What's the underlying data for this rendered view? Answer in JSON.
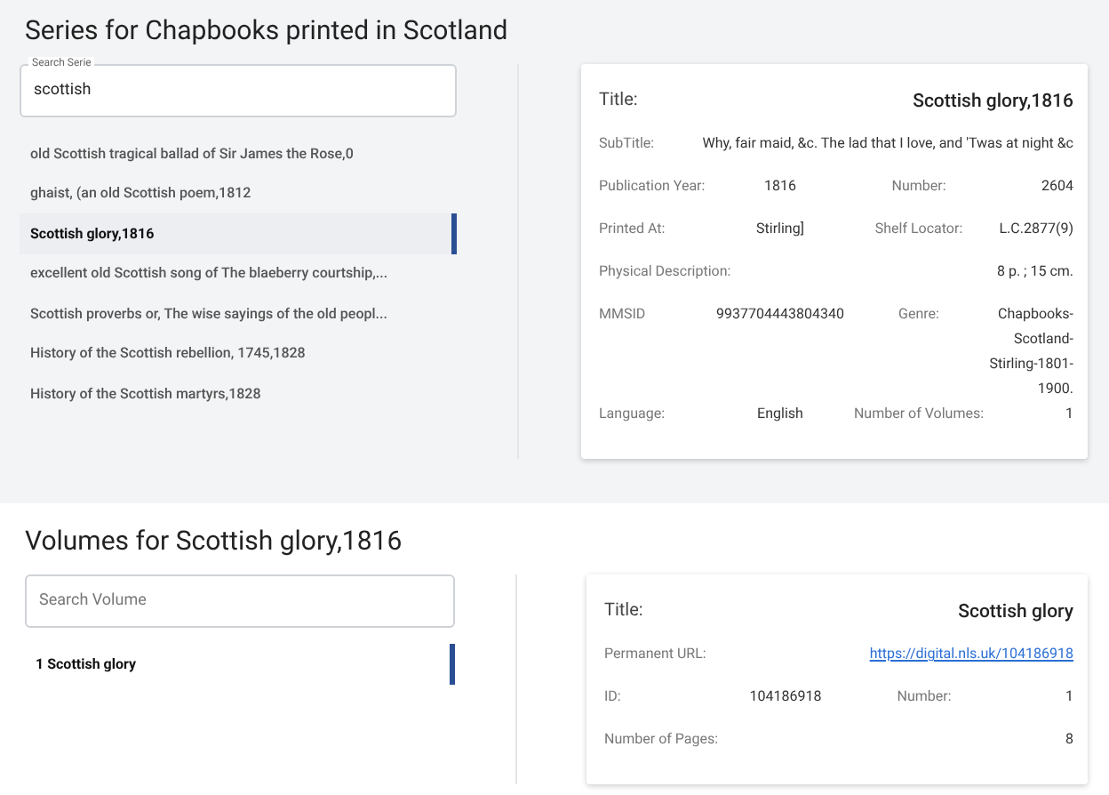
{
  "series": {
    "heading": "Series for Chapbooks printed in Scotland",
    "search": {
      "label": "Search Serie",
      "value": "scottish"
    },
    "items": [
      {
        "text": "old Scottish tragical ballad of Sir James the Rose,0",
        "selected": false
      },
      {
        "text": "ghaist, (an old Scottish poem,1812",
        "selected": false
      },
      {
        "text": "Scottish glory,1816",
        "selected": true
      },
      {
        "text": "excellent old Scottish song of The blaeberry courtship,...",
        "selected": false
      },
      {
        "text": "Scottish proverbs or, The wise sayings of the old peopl...",
        "selected": false
      },
      {
        "text": "History of the Scottish rebellion, 1745,1828",
        "selected": false
      },
      {
        "text": "History of the Scottish martyrs,1828",
        "selected": false
      }
    ],
    "detail": {
      "title_label": "Title:",
      "title_value": "Scottish glory,1816",
      "rows": [
        {
          "kind": "single",
          "label": "SubTitle:",
          "value": "Why, fair maid, &c. The lad that I love, and 'Twas at night &c"
        },
        {
          "kind": "pair",
          "fields": [
            {
              "label": "Publication Year:",
              "value": "1816"
            },
            {
              "label": "Number:",
              "value": "2604"
            }
          ]
        },
        {
          "kind": "pair",
          "fields": [
            {
              "label": "Printed At:",
              "value": "Stirling]"
            },
            {
              "label": "Shelf Locator:",
              "value": "L.C.2877(9)"
            }
          ]
        },
        {
          "kind": "single",
          "label": "Physical Description:",
          "value": "8 p. ; 15 cm."
        },
        {
          "kind": "pair",
          "fields": [
            {
              "label": "MMSID",
              "value": "9937704443804340"
            },
            {
              "label": "Genre:",
              "value": "Chapbooks-Scotland-Stirling-1801-1900."
            }
          ]
        },
        {
          "kind": "pair",
          "fields": [
            {
              "label": "Language:",
              "value": "English"
            },
            {
              "label": "Number of Volumes:",
              "value": "1"
            }
          ]
        }
      ]
    }
  },
  "volumes": {
    "heading": "Volumes for Scottish glory,1816",
    "search": {
      "placeholder": "Search Volume"
    },
    "items": [
      {
        "text": "1 Scottish glory",
        "selected": true
      }
    ],
    "detail": {
      "title_label": "Title:",
      "title_value": "Scottish glory",
      "rows": [
        {
          "kind": "link",
          "label": "Permanent URL:",
          "value": "https://digital.nls.uk/104186918"
        },
        {
          "kind": "pair",
          "fields": [
            {
              "label": "ID:",
              "value": "104186918"
            },
            {
              "label": "Number:",
              "value": "1"
            }
          ]
        },
        {
          "kind": "single",
          "label": "Number of Pages:",
          "value": "8"
        }
      ]
    }
  }
}
